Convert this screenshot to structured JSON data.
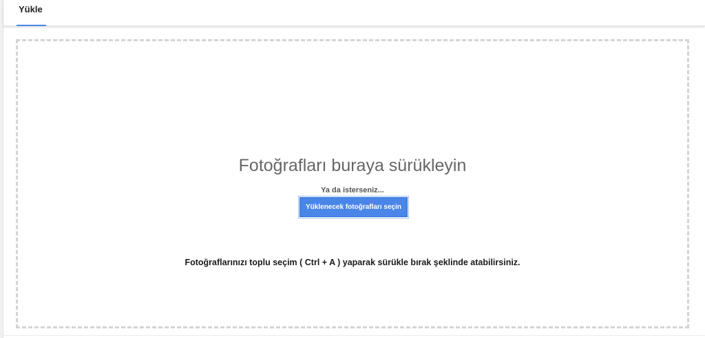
{
  "tabs": {
    "active_label": "Yükle"
  },
  "dropzone": {
    "title": "Fotoğrafları buraya sürükleyin",
    "or_text": "Ya da isterseniz...",
    "select_button_label": "Yüklenecek fotoğrafları seçin",
    "hint": "Fotoğraflarınızı toplu seçim ( Ctrl + A ) yaparak sürükle bırak şeklinde atabilirsiniz."
  },
  "colors": {
    "accent": "#4a86e8",
    "dashed_border": "#d4d4d4",
    "title_text": "#666666"
  }
}
